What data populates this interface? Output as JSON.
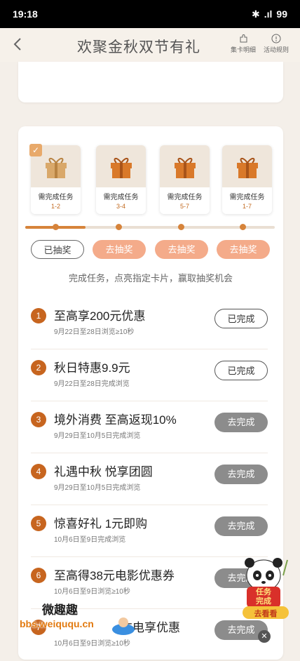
{
  "status_bar": {
    "time": "19:18",
    "battery": "99"
  },
  "header": {
    "title": "欢聚金秋双节有礼",
    "card_detail_label": "集卡明细",
    "rules_label": "活动规则"
  },
  "prizes": [
    {
      "label": "需完成任务",
      "range": "1-2",
      "checked": true
    },
    {
      "label": "需完成任务",
      "range": "3-4",
      "checked": false
    },
    {
      "label": "需完成任务",
      "range": "5-7",
      "checked": false
    },
    {
      "label": "需完成任务",
      "range": "1-7",
      "checked": false
    }
  ],
  "draw_buttons": [
    "已抽奖",
    "去抽奖",
    "去抽奖",
    "去抽奖"
  ],
  "hint": "完成任务，点亮指定卡片，赢取抽奖机会",
  "tasks": [
    {
      "num": "1",
      "name": "至高享200元优惠",
      "date": "9月22日至28日浏览≥10秒",
      "button": "已完成",
      "done": true
    },
    {
      "num": "2",
      "name": "秋日特惠9.9元",
      "date": "9月22日至28日完成浏览",
      "button": "已完成",
      "done": true
    },
    {
      "num": "3",
      "name": "境外消费 至高返现10%",
      "date": "9月29日至10月5日完成浏览",
      "button": "去完成",
      "done": false
    },
    {
      "num": "4",
      "name": "礼遇中秋 悦享团圆",
      "date": "9月29日至10月5日完成浏览",
      "button": "去完成",
      "done": false
    },
    {
      "num": "5",
      "name": "惊喜好礼 1元即购",
      "date": "10月6日至9日完成浏览",
      "button": "去完成",
      "done": false
    },
    {
      "num": "6",
      "name": "至高得38元电影优惠券",
      "date": "10月6日至9日浏览≥10秒",
      "button": "去完成",
      "done": false
    },
    {
      "num": "7",
      "name": "充电享优惠",
      "date": "10月6日至9日浏览≥10秒",
      "button": "去完成",
      "done": false
    }
  ],
  "mascot": {
    "line1": "任务",
    "line2": "完成",
    "button": "去看看"
  },
  "watermark": {
    "line1": "微趣趣",
    "line2": "bbs.weiququ.cn"
  },
  "colors": {
    "accent": "#c7651f",
    "draw_go": "#f4ab8a",
    "todo": "#8c8c8c"
  }
}
